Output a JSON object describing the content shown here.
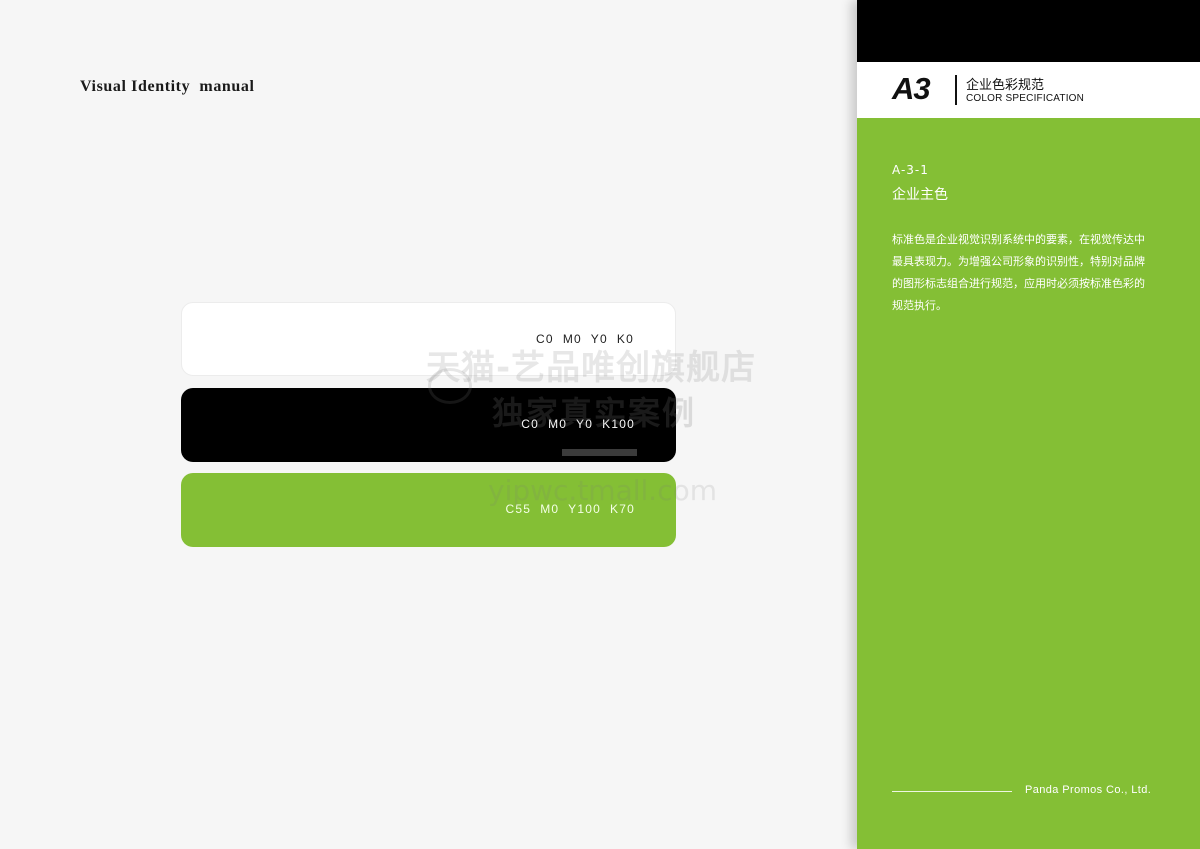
{
  "left_page": {
    "title": "Visual Identity  manual",
    "swatches": [
      {
        "label": "C0  M0  Y0  K0",
        "color": "#ffffff"
      },
      {
        "label": "C0  M0  Y0  K100",
        "color": "#000000"
      },
      {
        "label": "C55  M0  Y100  K70",
        "color": "#84bf35"
      }
    ]
  },
  "watermark": {
    "line1": "天猫-艺品唯创旗舰店",
    "line2": "独家真实案例",
    "line3": "yipwc.tmall.com"
  },
  "right_page": {
    "code": "A3",
    "title_cn": "企业色彩规范",
    "title_en": "COLOR SPECIFICATION",
    "section_number": "A-3-1",
    "section_title": "企业主色",
    "description": "标准色是企业视觉识别系统中的要素，在视觉传达中最具表现力。为增强公司形象的识别性，特别对品牌的图形标志组合进行规范，应用时必须按标准色彩的规范执行。",
    "company": "Panda Promos Co., Ltd.",
    "accent_color": "#84bf35"
  }
}
